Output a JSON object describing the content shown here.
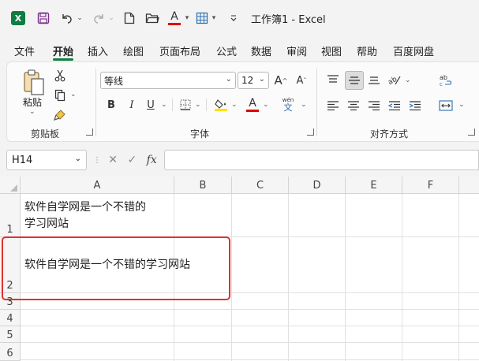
{
  "titlebar": {
    "title": "工作簿1  -  Excel",
    "logo": "X",
    "icons": [
      "excel-logo-icon",
      "save-icon",
      "undo-icon",
      "redo-icon",
      "new-file-icon",
      "open-folder-icon",
      "font-color-icon",
      "borders-icon",
      "customize-qat-icon"
    ]
  },
  "tabs": [
    "文件",
    "开始",
    "插入",
    "绘图",
    "页面布局",
    "公式",
    "数据",
    "审阅",
    "视图",
    "帮助",
    "百度网盘"
  ],
  "active_tab": "开始",
  "ribbon": {
    "clipboard": {
      "paste_label": "粘贴",
      "group_label": "剪贴板"
    },
    "font": {
      "font_name": "等线",
      "font_size": "12",
      "bold": "B",
      "italic": "I",
      "underline": "U",
      "font_color_glyph": "A",
      "phonetic_top": "wén",
      "phonetic_bottom": "文",
      "group_label": "字体"
    },
    "alignment": {
      "group_label": "对齐方式"
    }
  },
  "formula_bar": {
    "name_box": "H14",
    "fx": "fx",
    "formula": ""
  },
  "grid": {
    "columns": [
      "A",
      "B",
      "C",
      "D",
      "E",
      "F"
    ],
    "rows": [
      "1",
      "2",
      "3",
      "4",
      "5",
      "6"
    ],
    "cells": {
      "A1_line1": "软件自学网是一个不错的",
      "A1_line2": "学习网站",
      "A2": "软件自学网是一个不错的学习网站"
    }
  },
  "accent_color": "#107c41",
  "highlight_color": "#e03131"
}
